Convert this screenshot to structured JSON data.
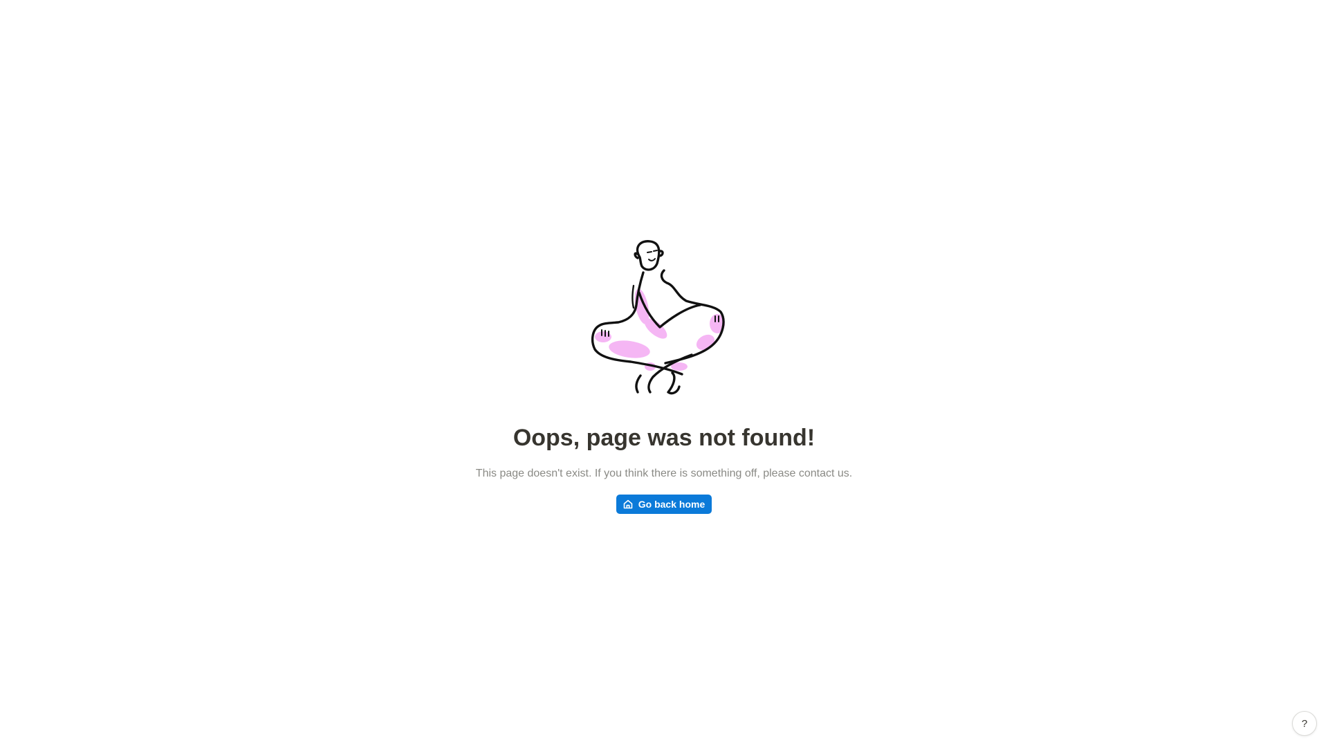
{
  "main": {
    "illustration_icon": "meditating-figure-illustration",
    "title": "Oops, page was not found!",
    "message": "This page doesn't exist. If you think there is something off, please contact us.",
    "home_button": {
      "icon": "home-icon",
      "label": "Go back home"
    }
  },
  "help_button": {
    "label": "?"
  },
  "colors": {
    "accent": "#0b7ad9",
    "title_text": "#37352f",
    "muted_text": "#8a8a85",
    "illustration_highlight": "#e879e8"
  }
}
